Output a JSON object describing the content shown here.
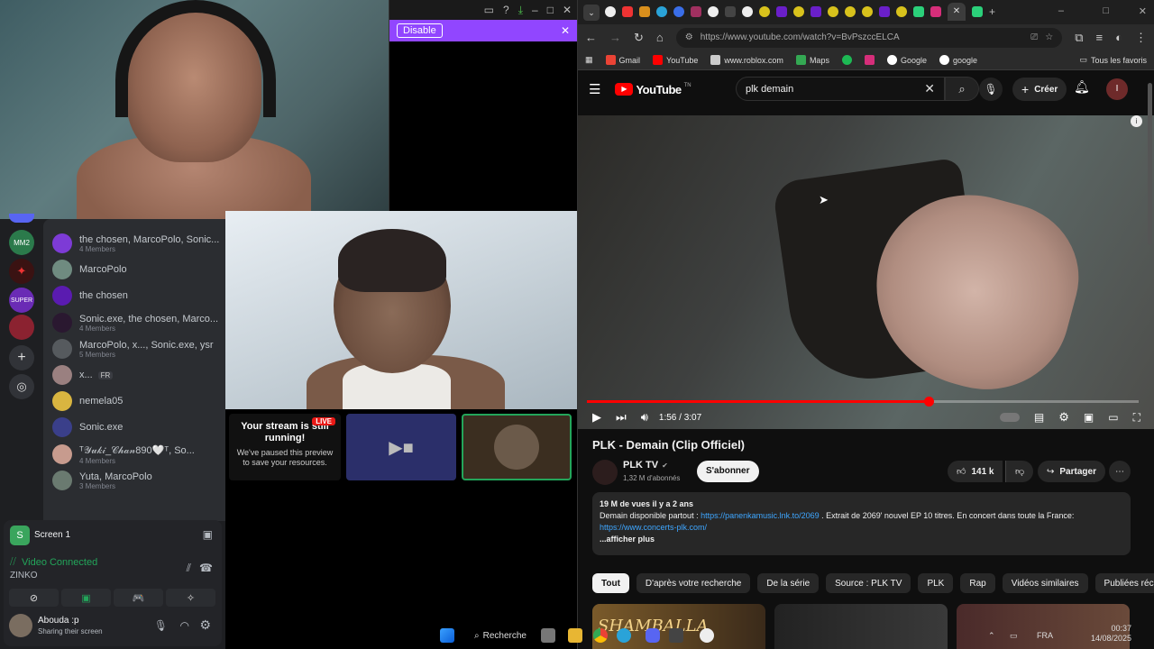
{
  "popup": {
    "disable_label": "Disable",
    "close": "✕"
  },
  "discord": {
    "dms": [
      {
        "name": "the chosen, MarcoPolo, Sonic...",
        "sub": "4 Members"
      },
      {
        "name": "MarcoPolo",
        "sub": ""
      },
      {
        "name": "the chosen",
        "sub": ""
      },
      {
        "name": "Sonic.exe, the chosen, Marco...",
        "sub": "4 Members"
      },
      {
        "name": "MarcoPolo, x..., Sonic.exe, ysr",
        "sub": "5 Members"
      },
      {
        "name": "x...",
        "sub": "",
        "tag": "FR"
      },
      {
        "name": "nemela05",
        "sub": ""
      },
      {
        "name": "Sonic.exe",
        "sub": ""
      },
      {
        "name": "ᵀ𝒴𝓊𝓀𝒾_𝒞𝒽𝒶𝓃890🤍ᵀ, So...",
        "sub": "4 Members"
      },
      {
        "name": "Yuta, MarcoPolo",
        "sub": "3 Members"
      }
    ],
    "voice": {
      "screen_label": "Screen 1",
      "status": "Video Connected",
      "server": "ZINKO"
    },
    "user": {
      "name": "Abouda :p",
      "status": "Sharing their screen"
    }
  },
  "stream": {
    "paused_title": "Your stream is still running!",
    "paused_body": "We've paused this preview to save your resources.",
    "live_badge": "LIVE"
  },
  "browser": {
    "url": "https://www.youtube.com/watch?v=BvPszccELCA",
    "bookmarks": [
      "Gmail",
      "YouTube",
      "www.roblox.com",
      "Maps",
      "Google",
      "google"
    ],
    "bookmarks_all": "Tous les favoris"
  },
  "youtube": {
    "logo": "YouTube",
    "logo_sup": "TN",
    "search_value": "plk demain",
    "create_label": "Créer",
    "avatar_letter": "I",
    "time": "1:56 / 3:07",
    "progress": 0.62,
    "title": "PLK - Demain (Clip Officiel)",
    "channel": "PLK TV",
    "subscribers": "1,32 M d'abonnés",
    "subscribe_label": "S'abonner",
    "likes": "141 k",
    "share_label": "Partager",
    "views_line": "19 M de vues  il y a 2 ans",
    "desc_prefix": "Demain disponible partout : ",
    "desc_link1": "https://panenkamusic.lnk.to/2069",
    "desc_suffix": " . Extrait de 2069' nouvel EP 10 titres. En concert dans toute la France:",
    "desc_link2": "https://www.concerts-plk.com/",
    "more_label": "...afficher plus",
    "chips": [
      "Tout",
      "D'après votre recherche",
      "De la série",
      "Source : PLK TV",
      "PLK",
      "Rap",
      "Vidéos similaires",
      "Publiées récemment"
    ],
    "thumb1_text": "SHAMBALLA"
  },
  "taskbar": {
    "search_label": "Recherche",
    "lang": "FRA",
    "time": "00:37",
    "date": "14/08/2025"
  }
}
